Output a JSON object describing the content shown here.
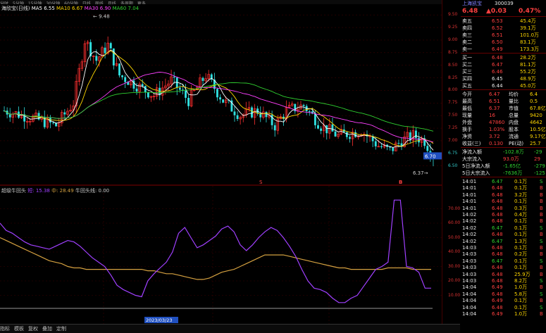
{
  "topbar": {
    "items": [
      "分时",
      "5分钟",
      "15分钟",
      "30分钟",
      "60分钟",
      "日线",
      "周线",
      "月线",
      "多周期",
      "更多"
    ]
  },
  "main": {
    "title": "海欣宝(日线)",
    "ma_legend": [
      {
        "label": "MA5",
        "value": "6.55",
        "color": "#ffffff"
      },
      {
        "label": "MA10",
        "value": "6.67",
        "color": "#ffd700"
      },
      {
        "label": "MA30",
        "value": "6.90",
        "color": "#ff40ff"
      },
      {
        "label": "MA60",
        "value": "7.04",
        "color": "#30d030"
      }
    ],
    "high_marker": "9.48",
    "low_marker": "6.37",
    "current_price_tag": "6.70",
    "marker_b": "B",
    "marker_s": "S"
  },
  "indicator": {
    "legend": [
      {
        "label": "超级牛回头",
        "color": "#c8c8c8"
      },
      {
        "label": "短",
        "value": "15.38",
        "color": "#a040ff"
      },
      {
        "label": "中",
        "value": "28.49",
        "color": "#d4a040"
      },
      {
        "label": "牛回头线",
        "value": "0.00",
        "color": "#c8c8c8"
      }
    ],
    "y_ticks": [
      "70.00",
      "60.00",
      "50.00",
      "40.00",
      "30.00",
      "20.00",
      "10.00"
    ],
    "date_tag": "2023/03/23"
  },
  "price_axis": [
    "9.50",
    "9.25",
    "9.00",
    "8.75",
    "8.50",
    "8.25",
    "8.00",
    "7.75",
    "7.50",
    "7.25",
    "7.00",
    "6.75",
    "6.50"
  ],
  "quote": {
    "name": "上海凯宝",
    "code": "300039",
    "price": "6.48",
    "change": "▲0.03",
    "pct": "0.47%",
    "asks": [
      {
        "label": "卖五",
        "price": "6.53",
        "vol": "45.4万"
      },
      {
        "label": "卖四",
        "price": "6.52",
        "vol": "39.1万"
      },
      {
        "label": "卖三",
        "price": "6.51",
        "vol": "101.0万"
      },
      {
        "label": "卖二",
        "price": "6.50",
        "vol": "83.1万"
      },
      {
        "label": "卖一",
        "price": "6.49",
        "vol": "173.3万"
      }
    ],
    "bids": [
      {
        "label": "买一",
        "price": "6.48",
        "vol": "28.2万"
      },
      {
        "label": "买二",
        "price": "6.47",
        "vol": "81.1万"
      },
      {
        "label": "买三",
        "price": "6.46",
        "vol": "55.2万"
      },
      {
        "label": "买四",
        "price": "6.45",
        "vol": "48.9万"
      },
      {
        "label": "买五",
        "price": "6.44",
        "vol": "45.0万"
      }
    ],
    "stats": [
      {
        "l1": "今开",
        "v1": "6.47",
        "l2": "均价",
        "v2": "6.4"
      },
      {
        "l1": "最高",
        "v1": "6.51",
        "l2": "量比",
        "v2": "0.5"
      },
      {
        "l1": "最低",
        "v1": "6.37",
        "l2": "市值",
        "v2": "67.8亿"
      },
      {
        "l1": "现量",
        "v1": "16",
        "l2": "总量",
        "v2": "9420"
      },
      {
        "l1": "外盘",
        "v1": "47860",
        "l2": "内盘",
        "v2": "4642"
      },
      {
        "l1": "换手",
        "v1": "1.03%",
        "l2": "股本",
        "v2": "10.5亿"
      },
      {
        "l1": "净资",
        "v1": "3.72",
        "l2": "流通",
        "v2": "9.17亿"
      },
      {
        "l1": "收益(三)",
        "v1": "0.130",
        "l2": "PE(动)",
        "v2": "25.7"
      }
    ],
    "flows": [
      {
        "label": "净流入额",
        "value": "-102.8万",
        "extra": "-29"
      },
      {
        "label": "大宗流入",
        "value": "93.0万",
        "extra": "29"
      },
      {
        "label": "5日净流入额",
        "value": "-1.65亿",
        "extra": "-279"
      },
      {
        "label": "5日大宗流入",
        "value": "-7636万",
        "extra": "-125"
      }
    ],
    "ticks": [
      {
        "t": "14:01",
        "p": "6.47",
        "v": "0.1万",
        "d": "S"
      },
      {
        "t": "14:01",
        "p": "6.48",
        "v": "0.1万",
        "d": "B"
      },
      {
        "t": "14:01",
        "p": "6.48",
        "v": "3.2万",
        "d": "B"
      },
      {
        "t": "14:01",
        "p": "6.48",
        "v": "0.1万",
        "d": "B"
      },
      {
        "t": "14:01",
        "p": "6.48",
        "v": "0.3万",
        "d": "B"
      },
      {
        "t": "14:02",
        "p": "6.48",
        "v": "0.4万",
        "d": "B"
      },
      {
        "t": "14:02",
        "p": "6.48",
        "v": "0.1万",
        "d": "B"
      },
      {
        "t": "14:02",
        "p": "6.47",
        "v": "0.1万",
        "d": "S"
      },
      {
        "t": "14:02",
        "p": "6.48",
        "v": "0.1万",
        "d": "B"
      },
      {
        "t": "14:02",
        "p": "6.47",
        "v": "1.3万",
        "d": "S"
      },
      {
        "t": "14:03",
        "p": "6.48",
        "v": "0.1万",
        "d": "B"
      },
      {
        "t": "14:03",
        "p": "6.48",
        "v": "0.2万",
        "d": "B"
      },
      {
        "t": "14:03",
        "p": "6.47",
        "v": "0.1万",
        "d": "S"
      },
      {
        "t": "14:03",
        "p": "6.48",
        "v": "0.1万",
        "d": "B"
      },
      {
        "t": "14:03",
        "p": "6.48",
        "v": "25.9万",
        "d": "B"
      },
      {
        "t": "14:03",
        "p": "6.48",
        "v": "8.2万",
        "d": "S"
      },
      {
        "t": "14:04",
        "p": "6.49",
        "v": "1.0万",
        "d": "B"
      },
      {
        "t": "14:04",
        "p": "6.48",
        "v": "5.8万",
        "d": "S"
      },
      {
        "t": "14:04",
        "p": "6.49",
        "v": "0.1万",
        "d": "B"
      },
      {
        "t": "14:04",
        "p": "6.48",
        "v": "0.1万",
        "d": "S"
      },
      {
        "t": "14:04",
        "p": "6.49",
        "v": "1.0万",
        "d": "B"
      }
    ]
  },
  "bottombar": {
    "items": [
      "指标",
      "模板",
      "复权",
      "叠加",
      "定制"
    ]
  },
  "chart_data": [
    {
      "type": "candlestick",
      "title": "海欣宝(日线)",
      "ylim": [
        6.3,
        9.6
      ],
      "series_ma": [
        {
          "name": "MA5",
          "last": 6.55
        },
        {
          "name": "MA10",
          "last": 6.67
        },
        {
          "name": "MA30",
          "last": 6.9
        },
        {
          "name": "MA60",
          "last": 7.04
        }
      ],
      "annotations": [
        {
          "label": "9.48",
          "kind": "high"
        },
        {
          "label": "6.37",
          "kind": "low"
        }
      ],
      "ma60": [
        7.3,
        7.35,
        7.5,
        7.8,
        8.0,
        8.05,
        7.95,
        7.9,
        7.8,
        7.65,
        7.55,
        7.45,
        7.45,
        7.48,
        7.5,
        7.45,
        7.35,
        7.3,
        7.25,
        7.2,
        7.1,
        7.05,
        7.0,
        6.95
      ]
    },
    {
      "type": "line",
      "title": "超级牛回头",
      "ylim": [
        0,
        80
      ],
      "series": [
        {
          "name": "短",
          "color": "#a040ff",
          "values": [
            60,
            55,
            53,
            50,
            47,
            45,
            44,
            43,
            42,
            44,
            46,
            48,
            47,
            44,
            40,
            36,
            33,
            30,
            24,
            17,
            14,
            12,
            10,
            9,
            20,
            25,
            29,
            33,
            40,
            53,
            57,
            50,
            43,
            45,
            48,
            51,
            56,
            58,
            54,
            45,
            41,
            45,
            50,
            54,
            57,
            55,
            50,
            44,
            37,
            28,
            20,
            15,
            14,
            12,
            8,
            5,
            5,
            8,
            10,
            16,
            22,
            28,
            30,
            33,
            76,
            76,
            30,
            29,
            26,
            15,
            15
          ]
        },
        {
          "name": "中",
          "color": "#d4a040",
          "values": [
            50,
            48,
            46,
            44,
            42,
            40,
            38,
            36,
            34,
            33,
            32,
            30,
            29,
            29,
            28,
            28,
            28,
            28,
            28,
            28,
            28,
            28,
            28,
            28,
            27,
            27,
            26,
            25,
            25,
            24,
            23,
            22,
            21,
            21,
            22,
            24,
            26,
            27,
            28,
            30,
            32,
            34,
            36,
            38,
            38,
            38,
            38,
            37,
            36,
            35,
            34,
            33,
            32,
            31,
            30,
            29,
            29,
            28,
            28,
            28,
            28,
            28,
            28,
            29,
            29,
            29,
            29,
            28,
            28,
            28,
            28
          ]
        },
        {
          "name": "牛回头线",
          "color": "#c8c8c8",
          "values": [
            0,
            0
          ]
        }
      ]
    }
  ]
}
